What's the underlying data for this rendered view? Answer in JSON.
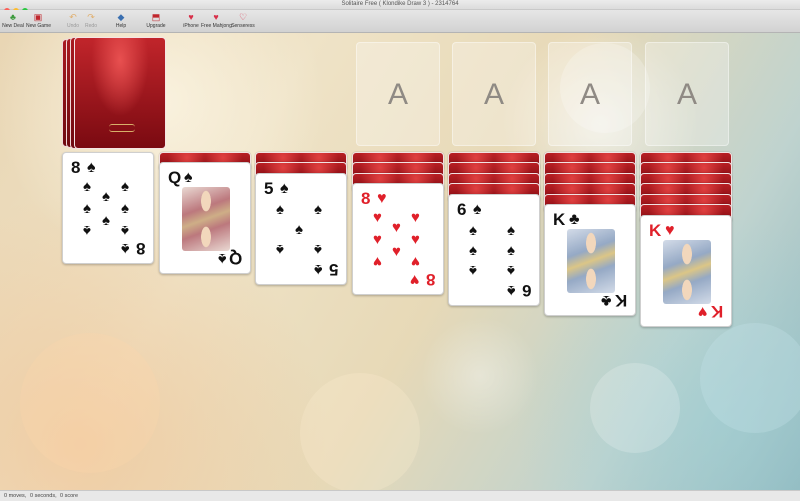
{
  "window": {
    "title": "Solitaire Free ( Klondike Draw 3 ) - 2314764"
  },
  "toolbar": [
    {
      "id": "new-deal",
      "label": "New Deal",
      "icon": "new-deal-icon",
      "enabled": true
    },
    {
      "id": "new-game",
      "label": "New Game",
      "icon": "new-game-icon",
      "enabled": true
    },
    {
      "id": "undo",
      "label": "Undo",
      "icon": "undo-icon",
      "enabled": false
    },
    {
      "id": "redo",
      "label": "Redo",
      "icon": "redo-icon",
      "enabled": false
    },
    {
      "id": "help",
      "label": "Help",
      "icon": "help-icon",
      "enabled": true
    },
    {
      "id": "upgrade",
      "label": "Upgrade",
      "icon": "upgrade-icon",
      "enabled": true
    },
    {
      "id": "iphone",
      "label": "iPhone",
      "icon": "iphone-icon",
      "enabled": true
    },
    {
      "id": "free-mahjong",
      "label": "Free Mahjong",
      "icon": "mahjong-icon",
      "enabled": true
    },
    {
      "id": "senseress",
      "label": "Senseress",
      "icon": "senseress-icon",
      "enabled": true
    }
  ],
  "foundations": [
    "A",
    "A",
    "A",
    "A"
  ],
  "tableau": [
    {
      "rank": "8",
      "suit": "♠",
      "color": "black",
      "hidden": 0
    },
    {
      "rank": "Q",
      "suit": "♠",
      "color": "black",
      "hidden": 1
    },
    {
      "rank": "5",
      "suit": "♠",
      "color": "black",
      "hidden": 2
    },
    {
      "rank": "8",
      "suit": "♥",
      "color": "red",
      "hidden": 3
    },
    {
      "rank": "6",
      "suit": "♠",
      "color": "black",
      "hidden": 4
    },
    {
      "rank": "K",
      "suit": "♣",
      "color": "black",
      "hidden": 5
    },
    {
      "rank": "K",
      "suit": "♥",
      "color": "red",
      "hidden": 6
    }
  ],
  "status": {
    "moves": "0 moves,",
    "time": "0 seconds,",
    "score": "0 score"
  },
  "colors": {
    "card_back": "#a91a20",
    "felt": "#e9d6b4"
  }
}
